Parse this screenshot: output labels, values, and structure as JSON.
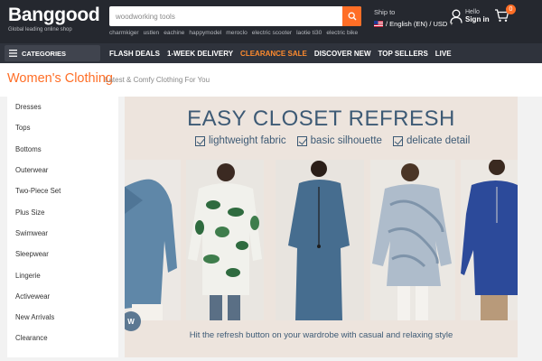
{
  "header": {
    "logo": "Banggood",
    "logo_tagline": "Global leading online shop",
    "search_placeholder": "woodworking tools",
    "hot_words": [
      "charmkiger",
      "ustlen",
      "eachine",
      "happymodel",
      "meroclo",
      "electric scooter",
      "laotie ti30",
      "electric bike"
    ],
    "ship_to_label": "Ship to",
    "ship_to_value": "/ English (EN) / USD",
    "hello": "Hello",
    "sign_in": "Sign in",
    "cart_count": "0"
  },
  "nav": {
    "categories": "CATEGORIES",
    "links": [
      "FLASH DEALS",
      "1-WEEK DELIVERY",
      "CLEARANCE SALE",
      "DISCOVER NEW",
      "TOP SELLERS",
      "LIVE"
    ],
    "highlight": "CLEARANCE SALE"
  },
  "page": {
    "title": "Women's Clothing",
    "subtitle": "Latest & Comfy Clothing For You"
  },
  "sidebar": {
    "items": [
      "Dresses",
      "Tops",
      "Bottoms",
      "Outerwear",
      "Two-Piece Set",
      "Plus Size",
      "Swimwear",
      "Sleepwear",
      "Lingerie",
      "Activewear",
      "New Arrivals",
      "Clearance"
    ]
  },
  "banner": {
    "title": "EASY CLOSET REFRESH",
    "features": [
      "lightweight fabric",
      "basic silhouette",
      "delicate detail"
    ],
    "footer": "Hit the refresh button on your wardrobe with casual and relaxing style",
    "badge": "W"
  },
  "colors": {
    "accent": "#ff6e26",
    "header_bg": "#25282f",
    "banner_text": "#3d5a75"
  }
}
